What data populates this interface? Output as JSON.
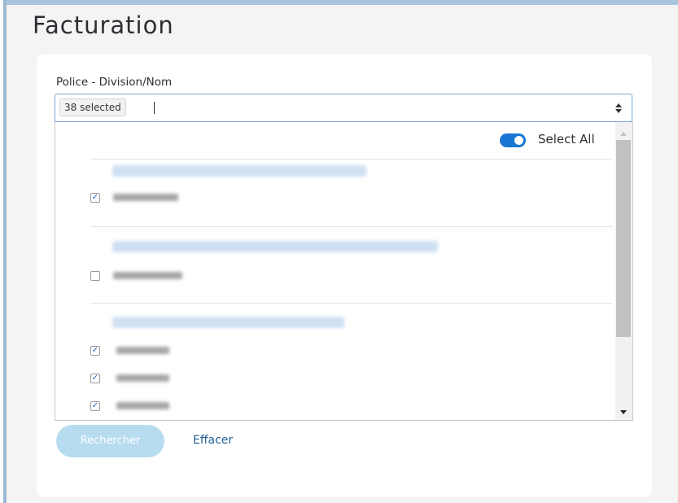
{
  "page": {
    "title": "Facturation"
  },
  "form": {
    "field_label": "Police - Division/Nom",
    "selected_tag": "38 selected"
  },
  "dropdown": {
    "select_all_label": "Select All",
    "select_all_on": true,
    "groups": [
      {
        "options": [
          {
            "checked": true
          }
        ]
      },
      {
        "options": [
          {
            "checked": false
          }
        ]
      },
      {
        "options": [
          {
            "checked": true
          },
          {
            "checked": true
          },
          {
            "checked": true
          }
        ]
      }
    ]
  },
  "actions": {
    "search_label": "Rechercher",
    "clear_label": "Effacer"
  },
  "colors": {
    "accent": "#1976d2",
    "link": "#1f5f96",
    "button_disabled": "#b8dcef"
  }
}
